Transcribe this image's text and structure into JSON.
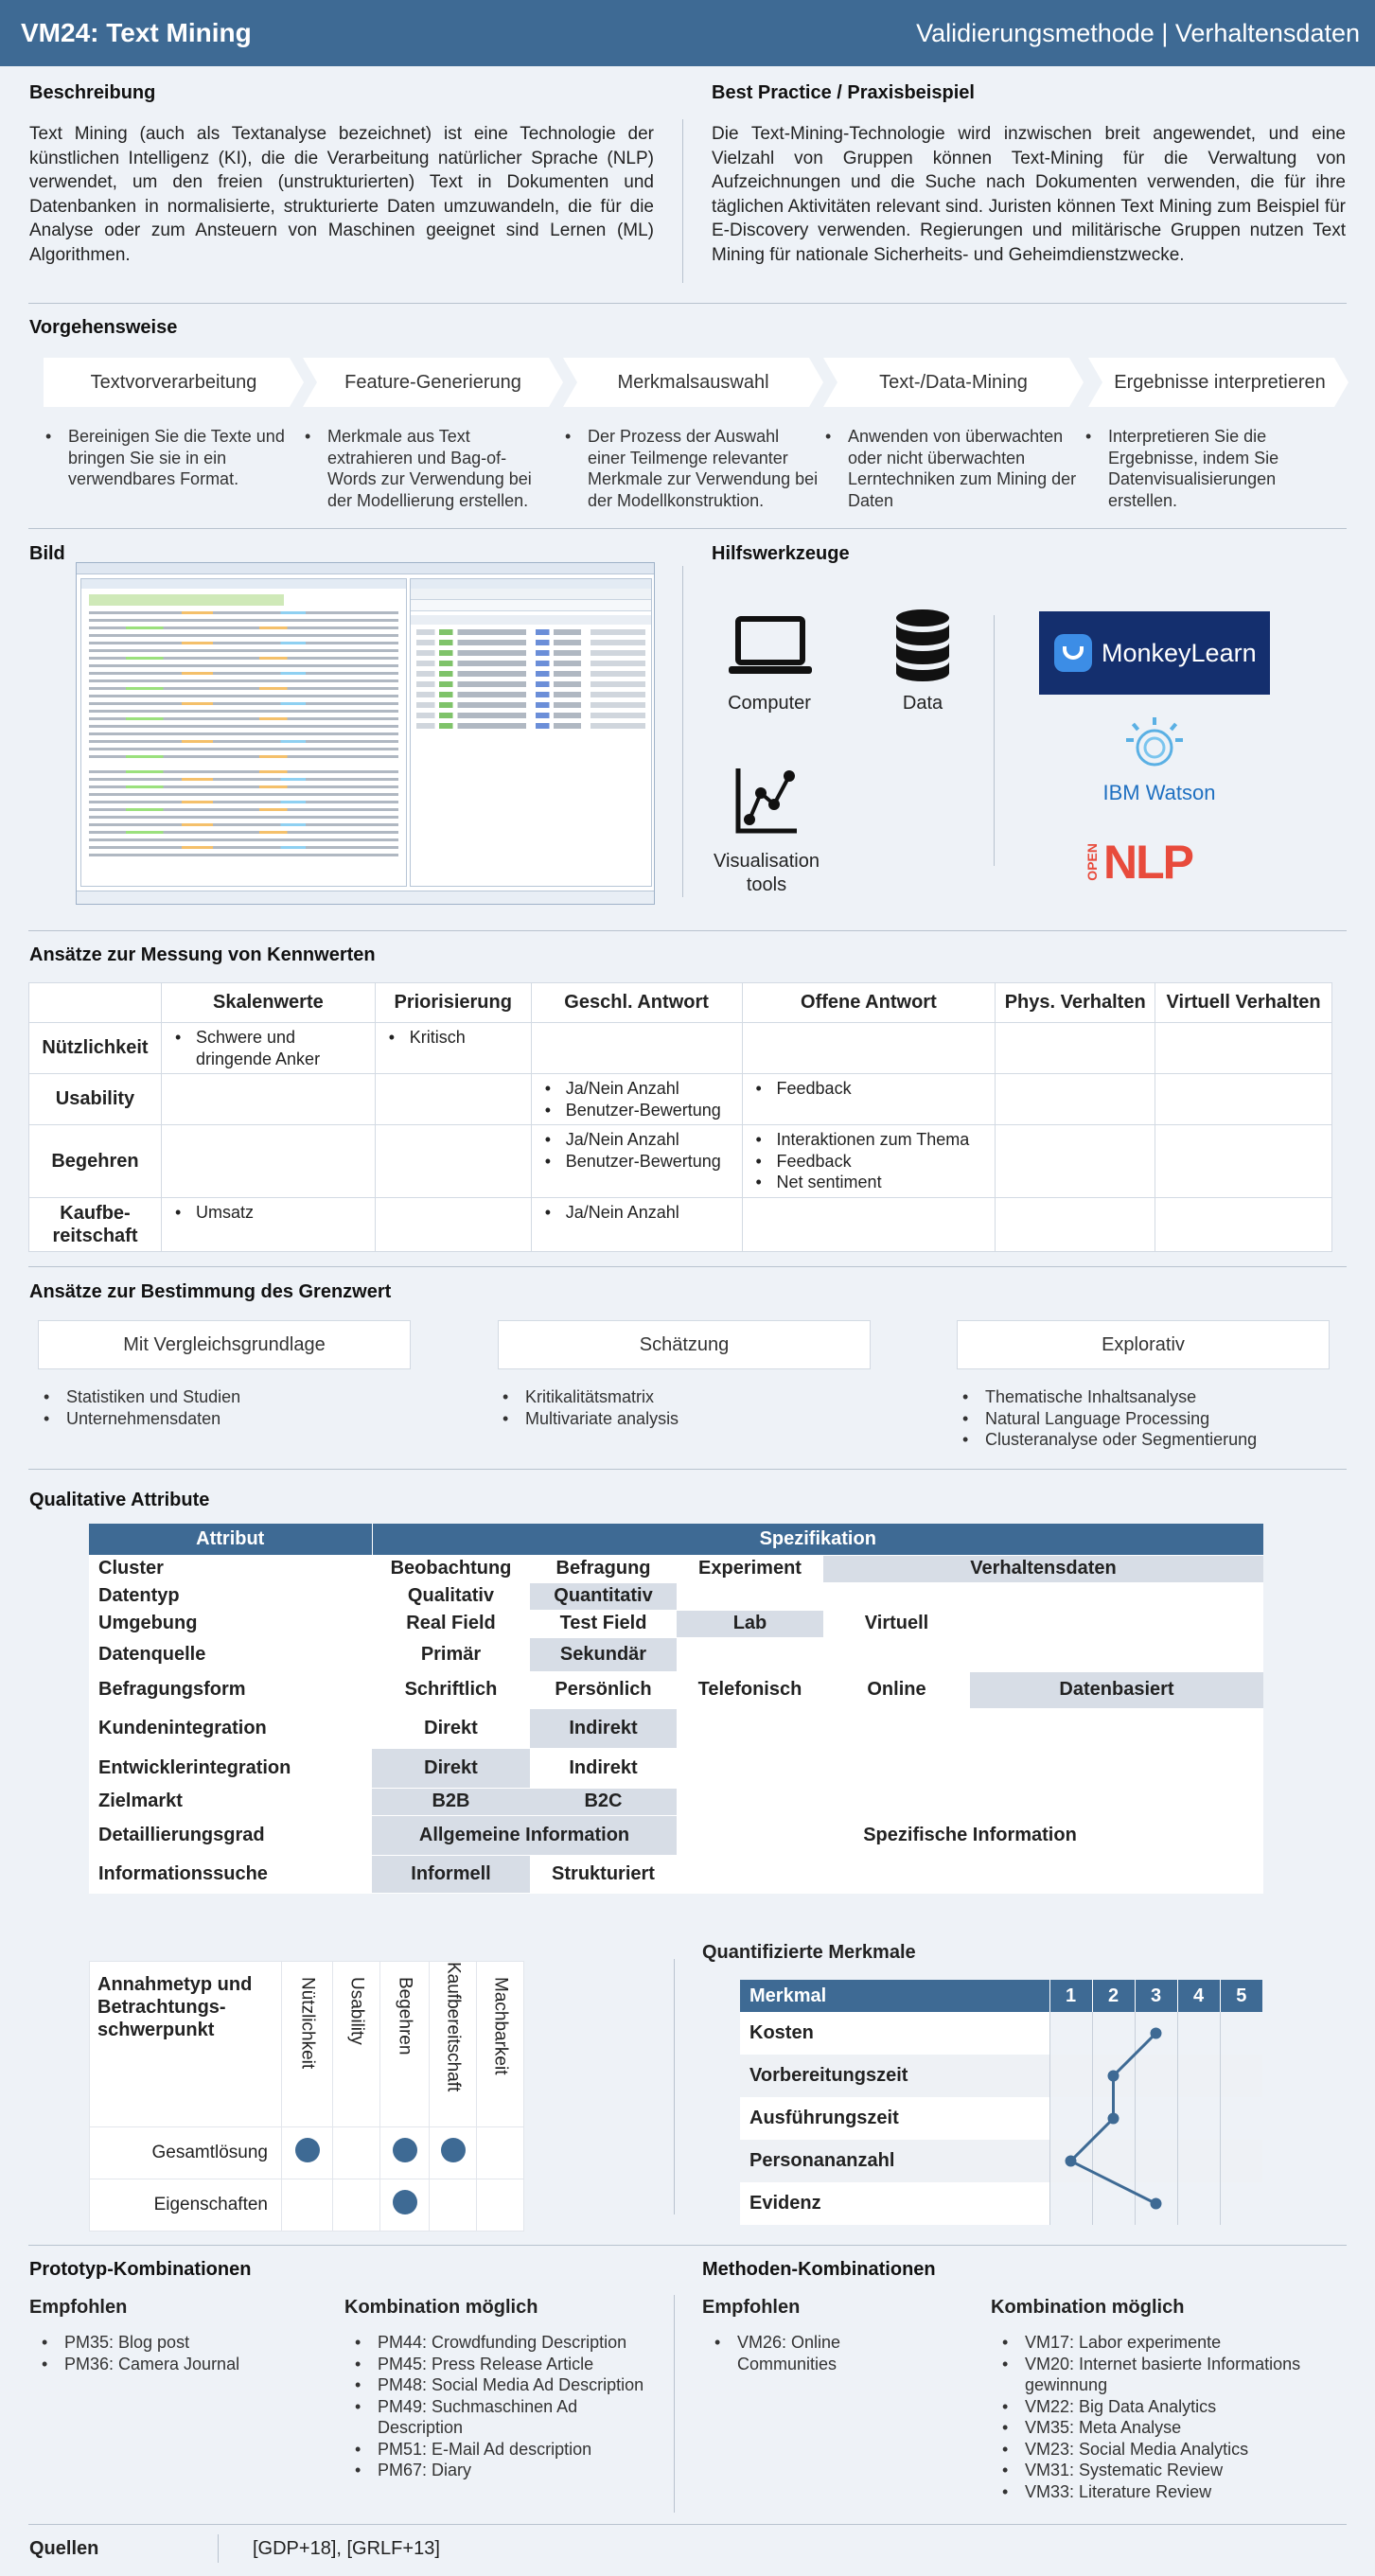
{
  "header": {
    "title": "VM24: Text Mining",
    "subtitle": "Validierungsmethode | Verhaltensdaten"
  },
  "beschreibung": {
    "heading": "Beschreibung",
    "text": "Text Mining (auch als Textanalyse bezeichnet) ist eine Technologie der künstlichen Intelligenz (KI), die die Verarbeitung natürlicher Sprache (NLP) verwendet, um den freien (unstrukturierten) Text in Dokumenten und Datenbanken in normalisierte, strukturierte Daten umzuwandeln, die für die Analyse oder zum Ansteuern von Maschinen geeignet sind Lernen (ML) Algorithmen."
  },
  "best_practice": {
    "heading": "Best Practice / Praxisbeispiel",
    "text": "Die Text-Mining-Technologie wird inzwischen breit angewendet, und eine Vielzahl von Gruppen können Text-Mining für die Verwaltung von Aufzeichnungen und die Suche nach Dokumenten verwenden, die für ihre täglichen Aktivitäten relevant sind. Juristen können Text Mining zum Beispiel für E-Discovery verwenden. Regierungen und militärische Gruppen nutzen Text Mining für nationale Sicherheits- und Geheimdienstzwecke."
  },
  "vorgehensweise": {
    "heading": "Vorgehensweise",
    "steps": [
      {
        "label": "Textvorverarbeitung",
        "desc": "Bereinigen Sie die Texte und bringen Sie sie in ein verwendbares Format."
      },
      {
        "label": "Feature-Generierung",
        "desc": "Merkmale aus Text extrahieren und Bag-of-Words zur Verwendung bei der Modellierung erstellen."
      },
      {
        "label": "Merkmalsauswahl",
        "desc": "Der Prozess der Auswahl einer Teilmenge relevanter Merkmale zur Verwendung bei der Modellkonstruktion."
      },
      {
        "label": "Text-/Data-Mining",
        "desc": "Anwenden von überwachten oder nicht überwachten Lerntechniken zum Mining der Daten"
      },
      {
        "label": "Ergebnisse interpretieren",
        "desc": "Interpretieren Sie die Ergebnisse, indem Sie Datenvisualisierungen erstellen."
      }
    ]
  },
  "bild": {
    "heading": "Bild"
  },
  "hilfswerkzeuge": {
    "heading": "Hilfswerkzeuge",
    "tools": [
      "Computer",
      "Data",
      "Visualisation tools"
    ],
    "logos": {
      "monkeylearn": "MonkeyLearn",
      "ibm": "IBM Watson",
      "opennlp_open": "OPEN",
      "opennlp_nlp": "NLP"
    }
  },
  "messung": {
    "heading": "Ansätze zur Messung von Kennwerten",
    "columns": [
      "Skalenwerte",
      "Priorisierung",
      "Geschl. Antwort",
      "Offene Antwort",
      "Phys. Verhalten",
      "Virtuell  Verhalten"
    ],
    "rows": [
      {
        "label": "Nützlichkeit",
        "cells": [
          [
            "Schwere und dringende Anker"
          ],
          [
            "Kritisch"
          ],
          [],
          [],
          [],
          []
        ]
      },
      {
        "label": "Usability",
        "cells": [
          [],
          [],
          [
            "Ja/Nein Anzahl",
            "Benutzer-Bewertung"
          ],
          [
            "Feedback"
          ],
          [],
          []
        ]
      },
      {
        "label": "Begehren",
        "cells": [
          [],
          [],
          [
            "Ja/Nein Anzahl",
            "Benutzer-Bewertung"
          ],
          [
            "Interaktionen zum Thema",
            "Feedback",
            "Net sentiment"
          ],
          [],
          []
        ]
      },
      {
        "label": "Kaufbe-\nreitschaft",
        "cells": [
          [
            "Umsatz"
          ],
          [],
          [
            "Ja/Nein Anzahl"
          ],
          [],
          [],
          []
        ]
      }
    ]
  },
  "grenzwert": {
    "heading": "Ansätze zur Bestimmung des Grenzwert",
    "boxes": [
      {
        "label": "Mit Vergleichsgrundlage",
        "items": [
          "Statistiken und Studien",
          "Unternehmensdaten"
        ]
      },
      {
        "label": "Schätzung",
        "items": [
          "Kritikalitätsmatrix",
          "Multivariate analysis"
        ]
      },
      {
        "label": "Explorativ",
        "items": [
          "Thematische Inhaltsanalyse",
          "Natural Language Processing",
          "Clusteranalyse oder Segmentierung"
        ]
      }
    ]
  },
  "qualitative": {
    "heading": "Qualitative Attribute",
    "col_attr": "Attribut",
    "col_spec": "Spezifikation",
    "rows": [
      {
        "label": "Cluster",
        "vals": [
          "Beobachtung",
          "Befragung",
          "Experiment",
          "Verhaltensdaten"
        ]
      },
      {
        "label": "Datentyp",
        "vals": [
          "Qualitativ",
          "Quantitativ"
        ]
      },
      {
        "label": "Umgebung",
        "vals": [
          "Real Field",
          "Test Field",
          "Lab",
          "Virtuell"
        ]
      },
      {
        "label": "Datenquelle",
        "vals": [
          "Primär",
          "Sekundär"
        ]
      },
      {
        "label": "Befragungsform",
        "vals": [
          "Schriftlich",
          "Persönlich",
          "Telefonisch",
          "Online",
          "Datenbasiert"
        ]
      },
      {
        "label": "Kundenintegration",
        "vals": [
          "Direkt",
          "Indirekt"
        ]
      },
      {
        "label": "Entwicklerintegration",
        "vals": [
          "Direkt",
          "Indirekt"
        ]
      },
      {
        "label": "Zielmarkt",
        "vals": [
          "B2B",
          "B2C"
        ]
      },
      {
        "label": "Detaillierungsgrad",
        "vals": [
          "Allgemeine  Information",
          "Spezifische Information"
        ]
      },
      {
        "label": "Informationssuche",
        "vals": [
          "Informell",
          "Strukturiert"
        ]
      }
    ]
  },
  "annahme": {
    "title": "Annahmetyp und Betrachtungs-schwerpunkt",
    "columns": [
      "Nützlichkeit",
      "Usability",
      "Begehren",
      "Kaufbereitschaft",
      "Machbarkeit"
    ],
    "rows": [
      {
        "label": "Gesamtlösung",
        "marks": [
          true,
          false,
          true,
          true,
          false
        ]
      },
      {
        "label": "Eigenschaften",
        "marks": [
          false,
          false,
          true,
          false,
          false
        ]
      }
    ]
  },
  "quantifiziert": {
    "heading": "Quantifizierte  Merkmale",
    "col_label": "Merkmal",
    "scale": [
      "1",
      "2",
      "3",
      "4",
      "5"
    ],
    "rows": [
      {
        "label": "Kosten",
        "value": 3
      },
      {
        "label": "Vorbereitungszeit",
        "value": 2
      },
      {
        "label": "Ausführungszeit",
        "value": 2
      },
      {
        "label": "Personananzahl",
        "value": 1
      },
      {
        "label": "Evidenz",
        "value": 3
      }
    ],
    "line_color": "#3e6a94"
  },
  "prototyp": {
    "heading": "Prototyp-Kombinationen",
    "empf_label": "Empfohlen",
    "empf": [
      "PM35: Blog post",
      "PM36: Camera Journal"
    ],
    "moeglich_label": "Kombination möglich",
    "moeglich": [
      "PM44: Crowdfunding Description",
      "PM45: Press Release Article",
      "PM48: Social Media Ad Description",
      "PM49: Suchmaschinen Ad Description",
      "PM51: E-Mail Ad description",
      "PM67: Diary"
    ]
  },
  "methoden": {
    "heading": "Methoden-Kombinationen",
    "empf_label": "Empfohlen",
    "empf": [
      "VM26: Online Communities"
    ],
    "moeglich_label": "Kombination möglich",
    "moeglich": [
      "VM17: Labor experimente",
      "VM20: Internet basierte Informations gewinnung",
      "VM22: Big Data Analytics",
      "VM35: Meta Analyse",
      "VM23: Social Media Analytics",
      "VM31: Systematic Review",
      "VM33: Literature Review"
    ]
  },
  "quellen": {
    "label": "Quellen",
    "value": "[GDP+18], [GRLF+13]"
  },
  "colors": {
    "header": "#3e6a94",
    "background": "#eef2f7",
    "highlight": "#d7dde6"
  }
}
